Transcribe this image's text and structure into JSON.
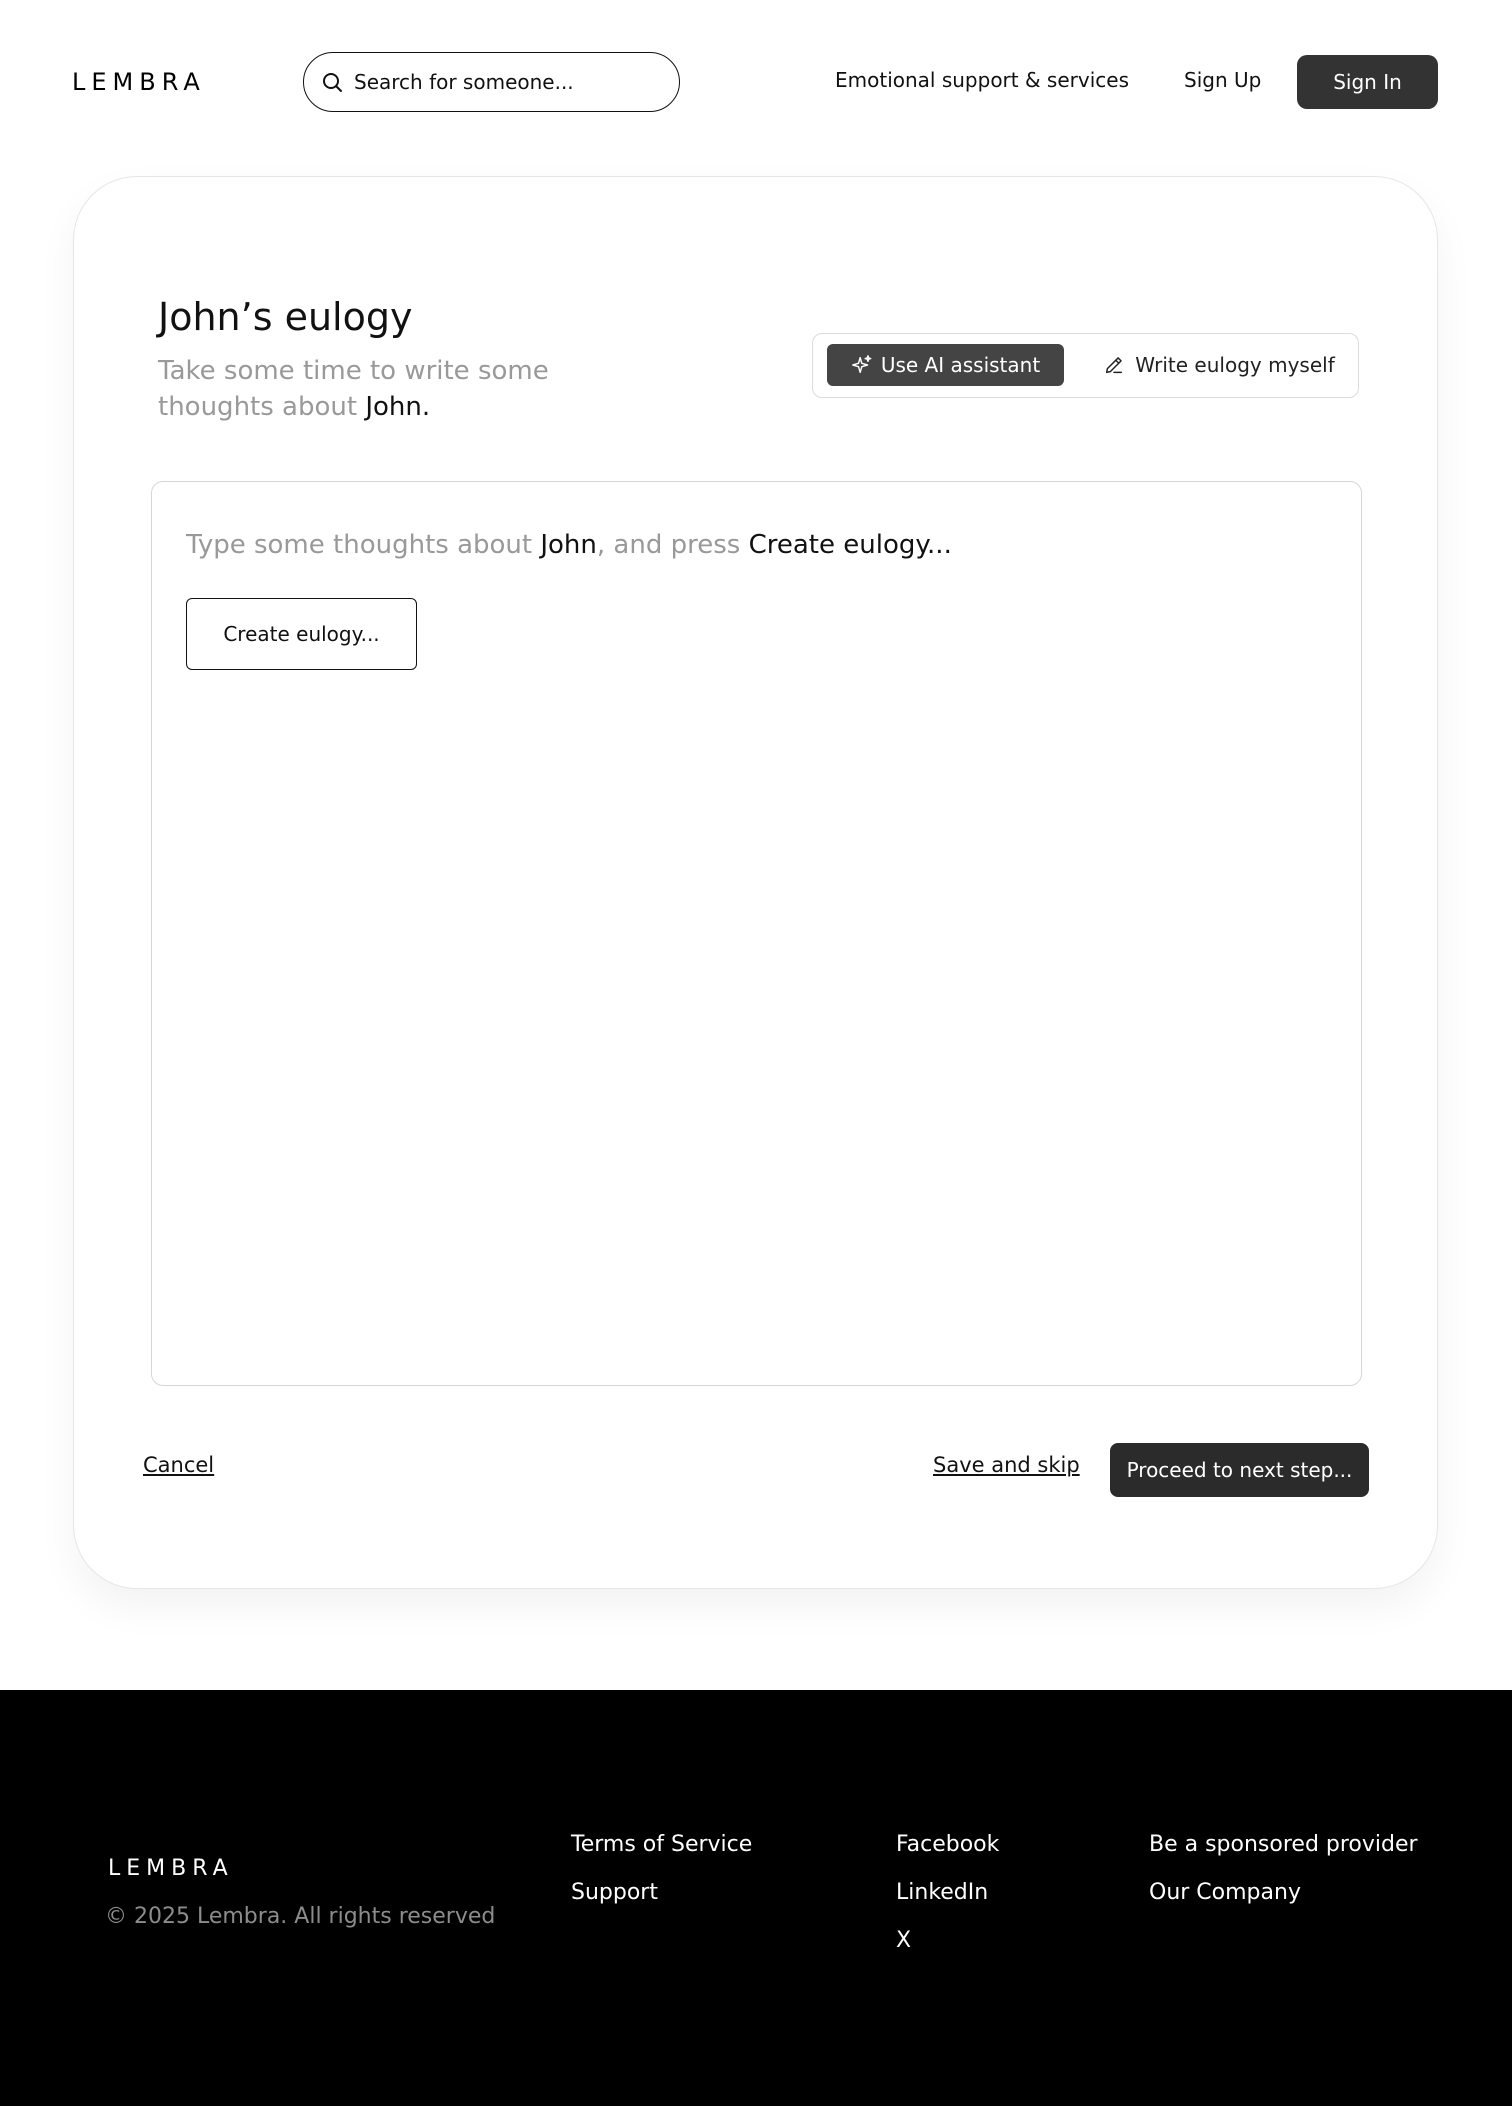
{
  "header": {
    "logo": "LEMBRA",
    "search_placeholder": "Search for someone...",
    "nav": {
      "services": "Emotional support & services",
      "sign_up": "Sign Up",
      "sign_in": "Sign In"
    }
  },
  "card": {
    "title": "John’s eulogy",
    "subtitle_prefix": "Take some time to write some thoughts about ",
    "subtitle_name": "John.",
    "modes": {
      "ai": "Use AI assistant",
      "self": "Write eulogy myself",
      "selected": "ai"
    },
    "editor": {
      "hint_part1": "Type some thoughts about ",
      "hint_name": "John",
      "hint_part2": ", and press ",
      "hint_action": "Create eulogy...",
      "create_button": "Create eulogy..."
    },
    "actions": {
      "cancel": "Cancel",
      "save_skip": "Save and skip",
      "proceed": "Proceed to next step..."
    }
  },
  "footer": {
    "logo": "LEMBRA",
    "copyright": "© 2025 Lembra. All rights reserved",
    "columns": [
      [
        "Terms of Service",
        "Support"
      ],
      [
        "Facebook",
        "LinkedIn",
        "X"
      ],
      [
        "Be a sponsored provider",
        "Our Company"
      ]
    ]
  },
  "colors": {
    "primary_button": "#333333",
    "muted_text": "#999999",
    "footer_bg": "#000000"
  }
}
